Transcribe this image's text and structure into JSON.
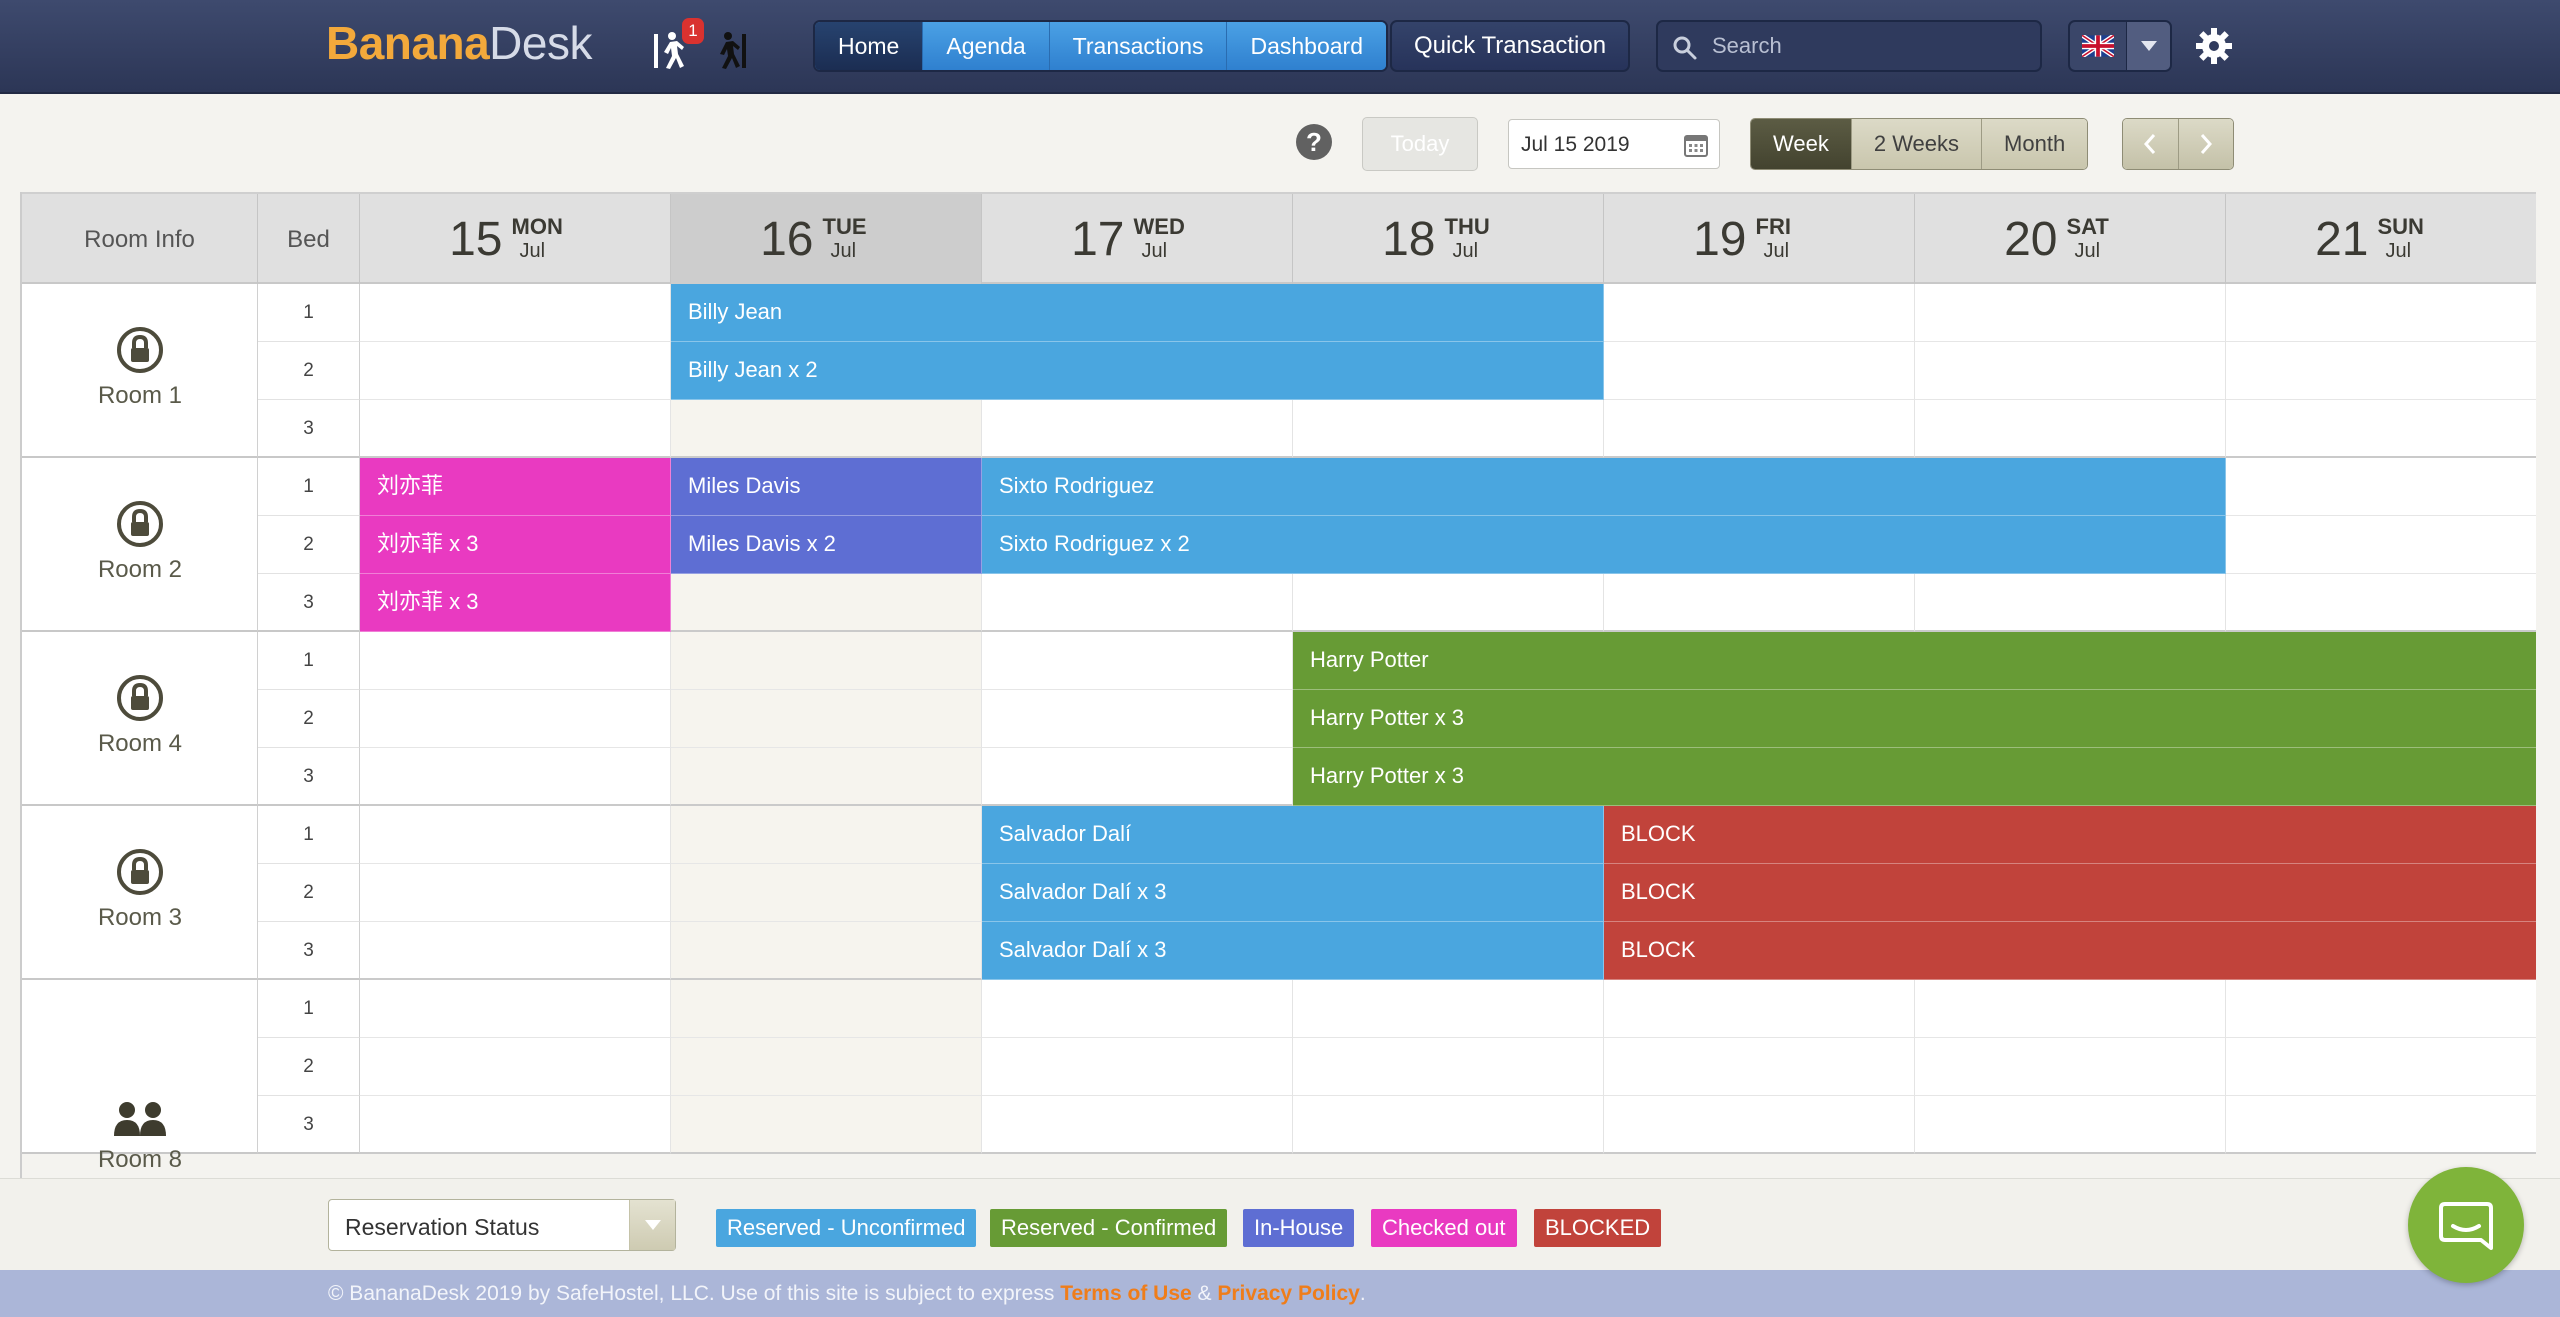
{
  "app": {
    "logo_part1": "Banana",
    "logo_part2": "Desk",
    "notification_count": "1"
  },
  "nav": {
    "tabs": [
      "Home",
      "Agenda",
      "Transactions",
      "Dashboard"
    ],
    "active": "Home"
  },
  "quick_transaction": "Quick Transaction",
  "search": {
    "placeholder": "Search"
  },
  "language": {
    "flag": "uk-flag-icon"
  },
  "toolbar": {
    "help": "?",
    "today": "Today",
    "date": "Jul 15 2019",
    "ranges": [
      "Week",
      "2 Weeks",
      "Month"
    ],
    "active_range": "Week"
  },
  "grid": {
    "room_info_header": "Room Info",
    "bed_header": "Bed",
    "days": [
      {
        "num": "15",
        "name": "MON",
        "month": "Jul"
      },
      {
        "num": "16",
        "name": "TUE",
        "month": "Jul",
        "selected": true
      },
      {
        "num": "17",
        "name": "WED",
        "month": "Jul"
      },
      {
        "num": "18",
        "name": "THU",
        "month": "Jul"
      },
      {
        "num": "19",
        "name": "FRI",
        "month": "Jul"
      },
      {
        "num": "20",
        "name": "SAT",
        "month": "Jul"
      },
      {
        "num": "21",
        "name": "SUN",
        "month": "Jul"
      }
    ],
    "rooms": [
      {
        "name": "Room 1",
        "icon": "lock-icon",
        "beds": [
          "1",
          "2",
          "3"
        ]
      },
      {
        "name": "Room 2",
        "icon": "lock-icon",
        "beds": [
          "1",
          "2",
          "3"
        ]
      },
      {
        "name": "Room 4",
        "icon": "lock-icon",
        "beds": [
          "1",
          "2",
          "3"
        ]
      },
      {
        "name": "Room 3",
        "icon": "lock-icon",
        "beds": [
          "1",
          "2",
          "3"
        ]
      },
      {
        "name": "Room 8",
        "icon": "people-icon",
        "beds": [
          "1",
          "2",
          "3"
        ]
      }
    ],
    "bookings": [
      {
        "room": 0,
        "bed": 0,
        "start": 1,
        "span": 3,
        "label": "Billy Jean",
        "status": "blue"
      },
      {
        "room": 0,
        "bed": 1,
        "start": 1,
        "span": 3,
        "label": "Billy Jean x 2",
        "status": "blue"
      },
      {
        "room": 1,
        "bed": 0,
        "start": 0,
        "span": 1,
        "label": "刘亦菲",
        "status": "pink"
      },
      {
        "room": 1,
        "bed": 1,
        "start": 0,
        "span": 1,
        "label": "刘亦菲 x 3",
        "status": "pink"
      },
      {
        "room": 1,
        "bed": 2,
        "start": 0,
        "span": 1,
        "label": "刘亦菲 x 3",
        "status": "pink"
      },
      {
        "room": 1,
        "bed": 0,
        "start": 1,
        "span": 1,
        "label": "Miles Davis",
        "status": "purple"
      },
      {
        "room": 1,
        "bed": 1,
        "start": 1,
        "span": 1,
        "label": "Miles Davis x 2",
        "status": "purple"
      },
      {
        "room": 1,
        "bed": 0,
        "start": 2,
        "span": 4,
        "label": "Sixto Rodriguez",
        "status": "blue"
      },
      {
        "room": 1,
        "bed": 1,
        "start": 2,
        "span": 4,
        "label": "Sixto Rodriguez x 2",
        "status": "blue"
      },
      {
        "room": 2,
        "bed": 0,
        "start": 3,
        "span": 4,
        "label": "Harry Potter",
        "status": "green"
      },
      {
        "room": 2,
        "bed": 1,
        "start": 3,
        "span": 4,
        "label": "Harry Potter x 3",
        "status": "green"
      },
      {
        "room": 2,
        "bed": 2,
        "start": 3,
        "span": 4,
        "label": "Harry Potter x 3",
        "status": "green"
      },
      {
        "room": 3,
        "bed": 0,
        "start": 2,
        "span": 2,
        "label": "Salvador Dalí",
        "status": "blue"
      },
      {
        "room": 3,
        "bed": 1,
        "start": 2,
        "span": 2,
        "label": "Salvador Dalí x 3",
        "status": "blue"
      },
      {
        "room": 3,
        "bed": 2,
        "start": 2,
        "span": 2,
        "label": "Salvador Dalí x 3",
        "status": "blue"
      },
      {
        "room": 3,
        "bed": 0,
        "start": 4,
        "span": 3,
        "label": "BLOCK",
        "status": "red"
      },
      {
        "room": 3,
        "bed": 1,
        "start": 4,
        "span": 3,
        "label": "BLOCK",
        "status": "red"
      },
      {
        "room": 3,
        "bed": 2,
        "start": 4,
        "span": 3,
        "label": "BLOCK",
        "status": "red"
      }
    ]
  },
  "legend": {
    "select_label": "Reservation Status",
    "chips": [
      {
        "label": "Reserved - Unconfirmed",
        "color": "#4aa6df"
      },
      {
        "label": "Reserved - Confirmed",
        "color": "#679b35"
      },
      {
        "label": "In-House",
        "color": "#5e6ed3"
      },
      {
        "label": "Checked out",
        "color": "#e93ac1"
      },
      {
        "label": "BLOCKED",
        "color": "#c1433b"
      }
    ]
  },
  "footer": {
    "text": "© BananaDesk 2019 by SafeHostel, LLC. Use of this site is subject to express ",
    "terms": "Terms of Use",
    "amp": " & ",
    "privacy": "Privacy Policy",
    "end": "."
  },
  "colors": {
    "accent": "#f3a93b",
    "topbar": "#2f3a5d"
  }
}
